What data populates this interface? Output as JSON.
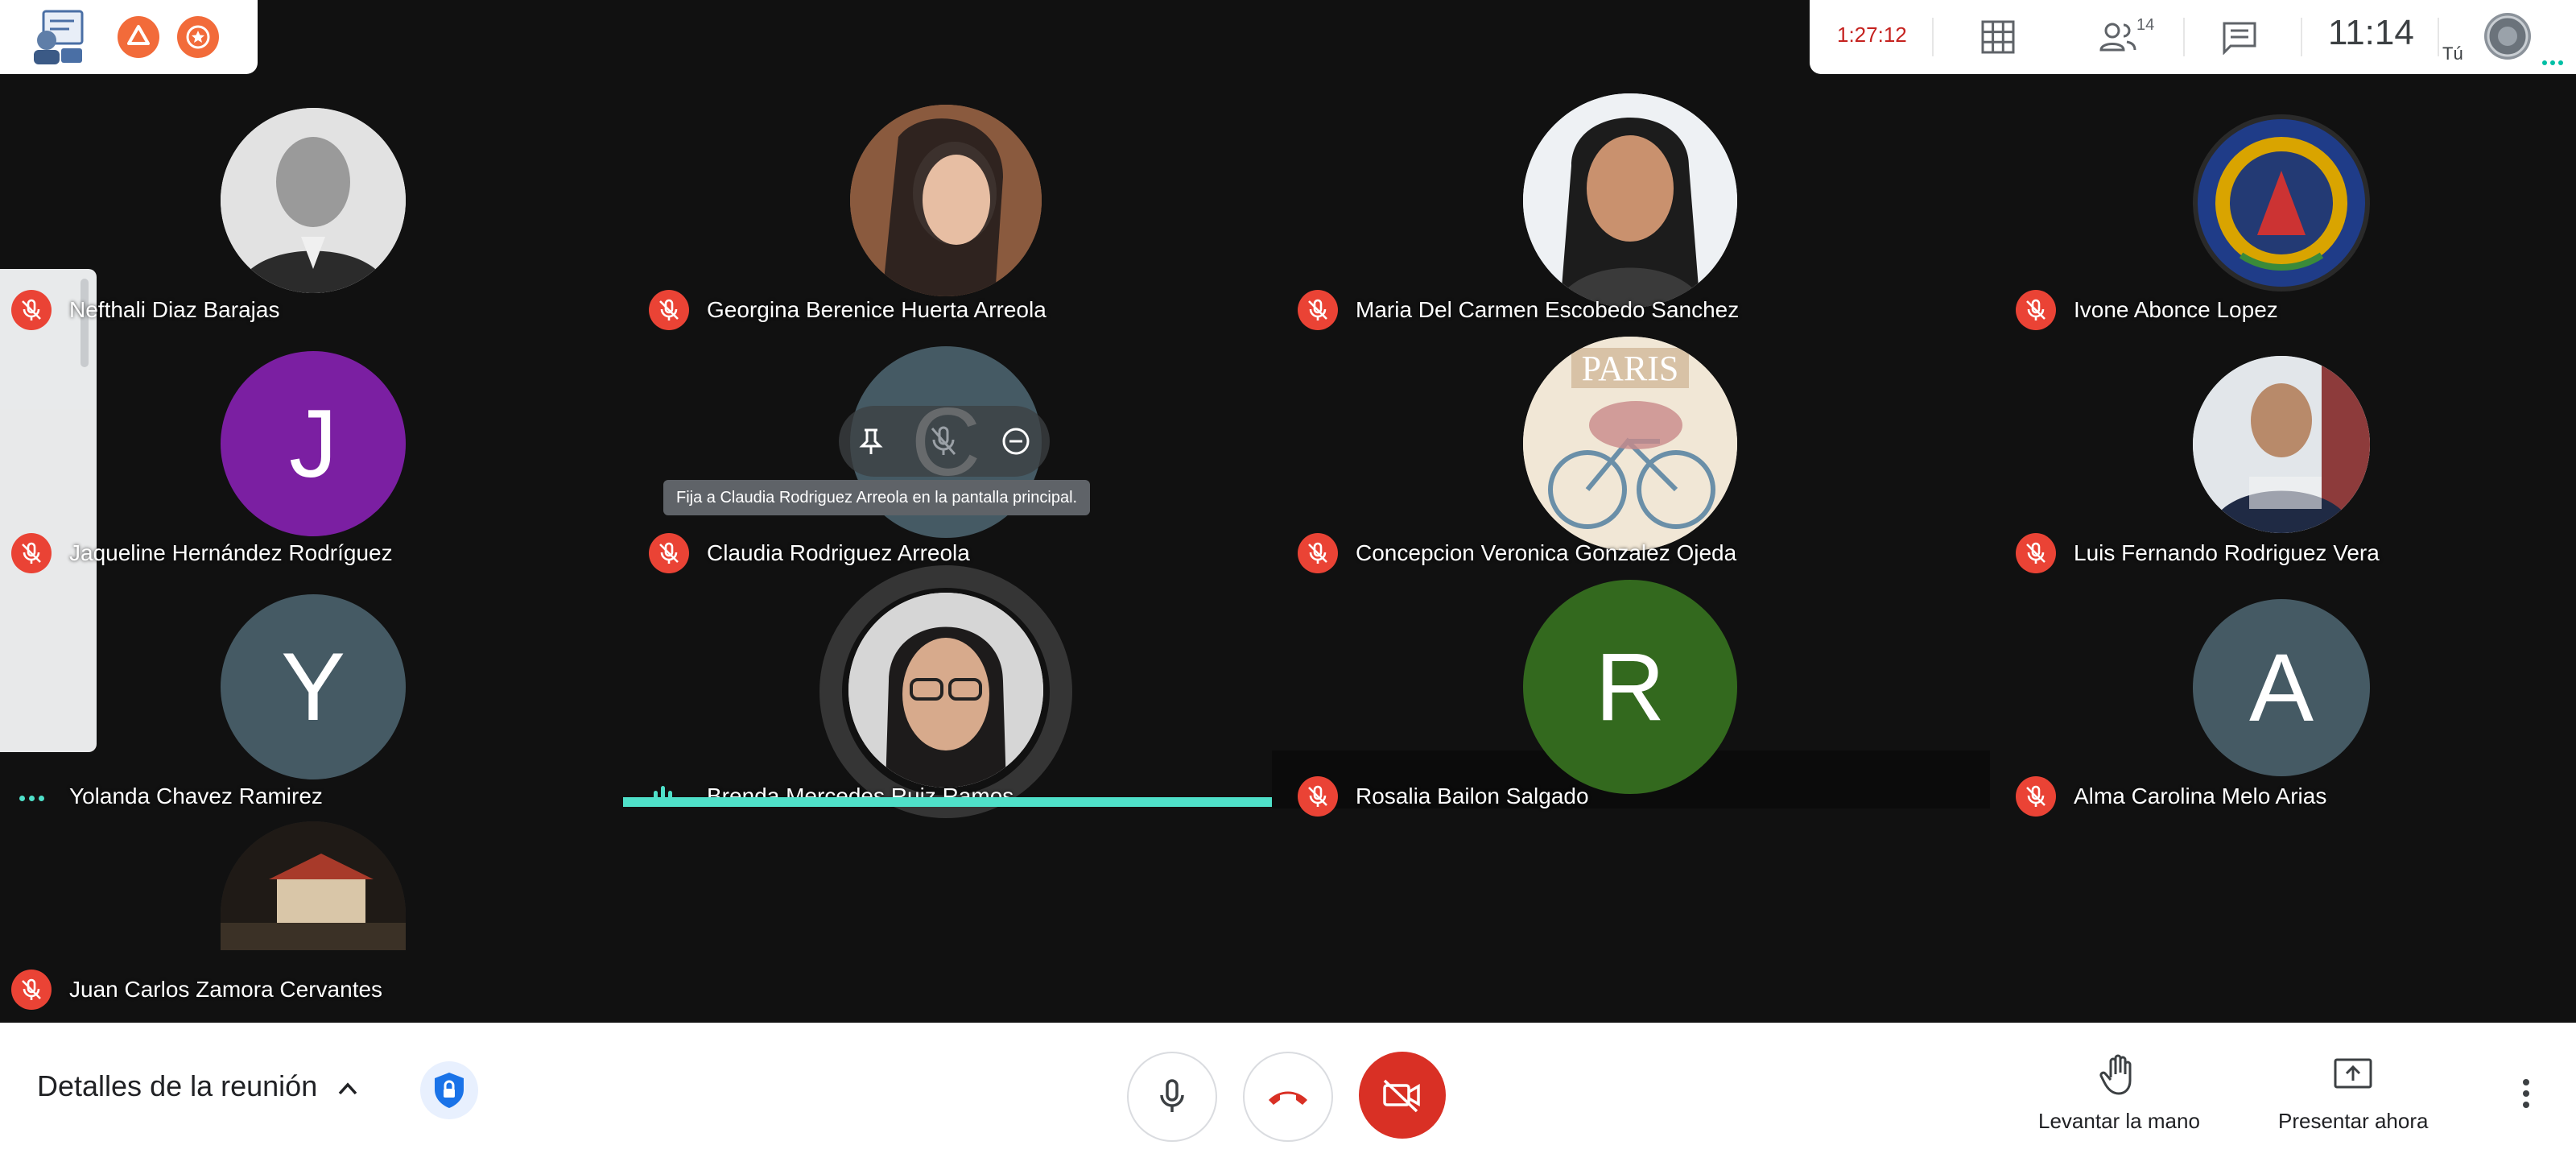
{
  "topbar": {
    "elapsed": "1:27:12",
    "participants_count": "14",
    "clock": "11:14",
    "self_label": "Tú"
  },
  "participants": [
    {
      "name": "Nefthali Diaz Barajas",
      "mic": "muted",
      "avatar": "photo"
    },
    {
      "name": "Georgina Berenice Huerta Arreola",
      "mic": "muted",
      "avatar": "photo"
    },
    {
      "name": "Maria Del Carmen Escobedo Sanchez",
      "mic": "muted",
      "avatar": "photo"
    },
    {
      "name": "Ivone Abonce Lopez",
      "mic": "muted",
      "avatar": "logo"
    },
    {
      "name": "Jaqueline Hernández Rodríguez",
      "mic": "muted",
      "avatar": "J"
    },
    {
      "name": "Claudia Rodriguez Arreola",
      "mic": "muted",
      "avatar": "C"
    },
    {
      "name": "Concepcion Veronica Gonzalez Ojeda",
      "mic": "muted",
      "avatar": "photo"
    },
    {
      "name": "Luis Fernando Rodriguez Vera",
      "mic": "muted",
      "avatar": "photo"
    },
    {
      "name": "Yolanda Chavez Ramirez",
      "mic": "connecting",
      "avatar": "Y"
    },
    {
      "name": "Brenda Mercedes Ruiz Ramos",
      "mic": "speaking",
      "avatar": "photo"
    },
    {
      "name": "Rosalia Bailon Salgado",
      "mic": "muted",
      "avatar": "R"
    },
    {
      "name": "Alma Carolina Melo Arias",
      "mic": "muted",
      "avatar": "A"
    },
    {
      "name": "Juan Carlos Zamora Cervantes",
      "mic": "muted",
      "avatar": "photo"
    }
  ],
  "tooltip": "Fija a Claudia Rodriguez Arreola en la pantalla principal.",
  "bottombar": {
    "details_label": "Detalles de la reunión",
    "raise_hand_label": "Levantar la mano",
    "present_label": "Presentar ahora"
  },
  "colors": {
    "muted_red": "#ea4335",
    "speaking_teal": "#4fe0c9",
    "hangup_red": "#d93025",
    "background": "#111111"
  }
}
